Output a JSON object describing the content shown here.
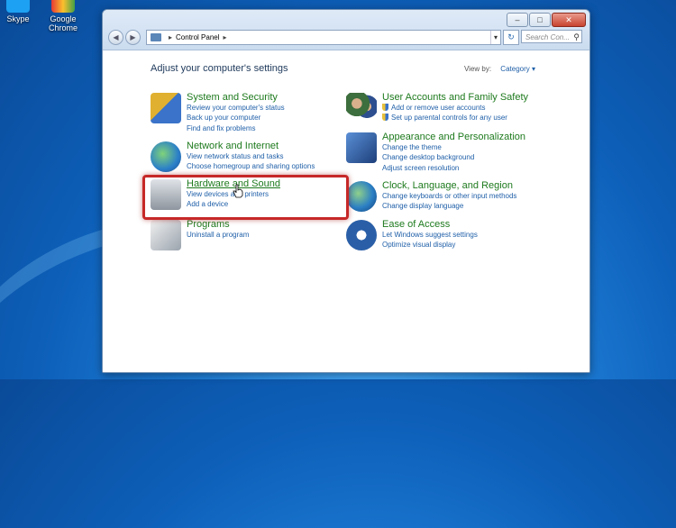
{
  "desktop": {
    "icons": [
      {
        "label": "Skype",
        "icon": "skype-icon"
      },
      {
        "label": "Google Chrome",
        "icon": "chrome-icon"
      }
    ]
  },
  "window": {
    "address": {
      "icon": "control-panel-icon",
      "path": "Control Panel"
    },
    "search_placeholder": "Search Con...",
    "caption_buttons": {
      "minimize": "–",
      "maximize": "□",
      "close": "✕"
    }
  },
  "content": {
    "heading": "Adjust your computer's settings",
    "view_by_label": "View by:",
    "view_by_value": "Category ▾",
    "categories": [
      {
        "id": "system-security",
        "title": "System and Security",
        "icon": "shield-computer-icon",
        "links": [
          "Review your computer's status",
          "Back up your computer",
          "Find and fix problems"
        ]
      },
      {
        "id": "network-internet",
        "title": "Network and Internet",
        "icon": "globe-network-icon",
        "links": [
          "View network status and tasks",
          "Choose homegroup and sharing options"
        ]
      },
      {
        "id": "hardware-sound",
        "title": "Hardware and Sound",
        "icon": "printer-speaker-icon",
        "links": [
          "View devices and printers",
          "Add a device"
        ]
      },
      {
        "id": "programs",
        "title": "Programs",
        "icon": "programs-icon",
        "links": [
          "Uninstall a program"
        ]
      },
      {
        "id": "user-accounts",
        "title": "User Accounts and Family Safety",
        "icon": "users-icon",
        "links": [
          "Add or remove user accounts",
          "Set up parental controls for any user"
        ]
      },
      {
        "id": "appearance",
        "title": "Appearance and Personalization",
        "icon": "monitor-paint-icon",
        "links": [
          "Change the theme",
          "Change desktop background",
          "Adjust screen resolution"
        ]
      },
      {
        "id": "clock-language",
        "title": "Clock, Language, and Region",
        "icon": "clock-globe-icon",
        "links": [
          "Change keyboards or other input methods",
          "Change display language"
        ]
      },
      {
        "id": "ease-of-access",
        "title": "Ease of Access",
        "icon": "ease-of-access-icon",
        "links": [
          "Let Windows suggest settings",
          "Optimize visual display"
        ]
      }
    ]
  },
  "colors": {
    "link": "#1f5fa8",
    "title": "#1e7a1e",
    "highlight": "#c62828"
  }
}
